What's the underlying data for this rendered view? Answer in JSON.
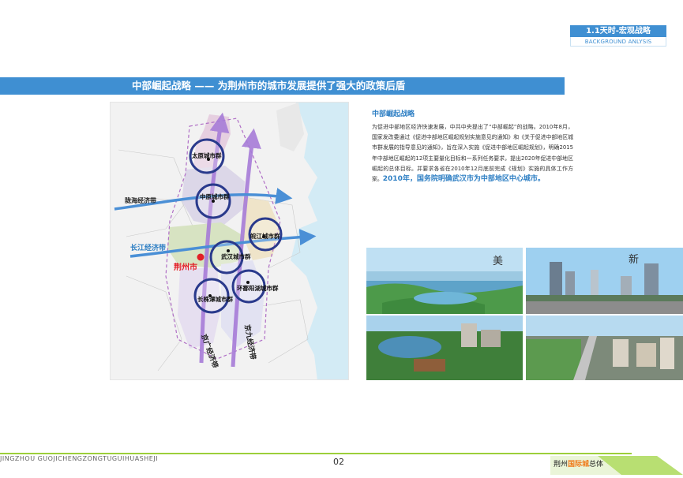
{
  "header": {
    "section_title": "1.1天时-宏观战略",
    "section_subtitle": "BACKGROUND ANLYSIS"
  },
  "title_bar": {
    "text": "中部崛起战略    ——  为荆州市的城市发展提供了强大的政策后盾"
  },
  "map": {
    "city_groups": {
      "taiyuan": "太原城市群",
      "zhongyuan": "中原城市群",
      "wanjiang": "皖江城市群",
      "wuhan": "武汉城市群",
      "huanpoyang": "环鄱阳湖城市群",
      "changzhutan": "长株潭城市群"
    },
    "belts": {
      "longhai": "陇海经济带",
      "changjiang": "长江经济带",
      "jingguang": "京广经济带",
      "jingjiu": "京九经济带"
    },
    "jingzhou": "荆州市",
    "colors": {
      "belt_arrow": "#4a8fd6",
      "vertical_arrow": "#a77cd8",
      "ring": "#2a3a8c",
      "jingzhou": "#e21f26"
    }
  },
  "text": {
    "heading": "中部崛起战略",
    "body": "为促进中部地区经济快速发展，中共中央提出了“中部崛起”的战略。2010年8月，国家发改委通过《促进中部地区崛起规划实施意见的通知》和《关于促进中部地区城市群发展的指导意见的通知》，旨在深入实施《促进中部地区崛起规划》，明确2015年中部地区崛起的12项主要量化目标和一系列任务要求，提出2020年促进中部地区崛起的总体目标。并要求各省在2010年12月底前完成《规划》实施的具体工作方案。",
    "highlight": "2010年，国务院明确武汉市为中部地区中心城市。"
  },
  "photos": {
    "photo1_glyph": "美",
    "photo2_glyph": "新"
  },
  "footer": {
    "left_text": "JINGZHOU  GUOJICHENGZONGTUGUIHUASHEJI",
    "page_number": "02",
    "right_prefix": "荆州",
    "right_highlight": "国际城",
    "right_suffix": "总体"
  }
}
